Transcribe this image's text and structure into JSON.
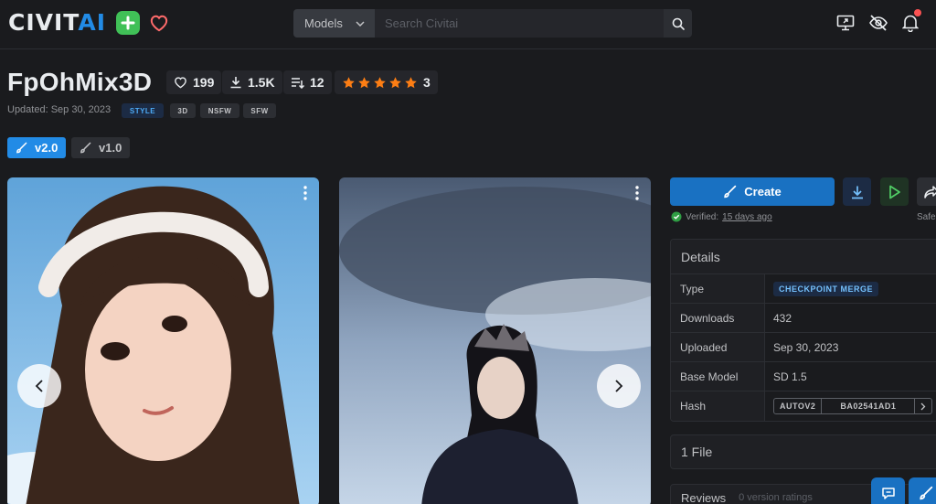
{
  "header": {
    "logo_prefix": "CIVIT",
    "logo_suffix": "AI",
    "search_select": "Models",
    "search_placeholder": "Search Civitai",
    "search_shortcut": "/"
  },
  "model": {
    "title": "FpOhMix3D",
    "likes": "199",
    "downloads": "1.5K",
    "versions_count": "12",
    "rating_stars": 5,
    "rating_count": "3",
    "updated": "Updated: Sep 30, 2023",
    "tags": [
      "STYLE",
      "3D",
      "NSFW",
      "SFW"
    ]
  },
  "versions": [
    {
      "label": "v2.0",
      "active": true
    },
    {
      "label": "v1.0",
      "active": false
    }
  ],
  "actions": {
    "create_label": "Create",
    "verified_prefix": "Verified:",
    "verified_link": "15 days ago",
    "safe_label": "Safe"
  },
  "details": {
    "heading": "Details",
    "type_label": "Type",
    "type_value": "CHECKPOINT MERGE",
    "downloads_label": "Downloads",
    "downloads_value": "432",
    "uploaded_label": "Uploaded",
    "uploaded_value": "Sep 30, 2023",
    "base_model_label": "Base Model",
    "base_model_value": "SD 1.5",
    "hash_label": "Hash",
    "hash_algo": "AUTOV2",
    "hash_value": "BA02541AD1"
  },
  "files": {
    "heading": "1 File"
  },
  "reviews": {
    "heading": "Reviews",
    "sub": "0 version ratings"
  },
  "colors": {
    "accent": "#228be6",
    "logo_plus": "#40c057",
    "heart": "#ff6b6b",
    "star": "#fd7e14",
    "play_green": "#51cf66",
    "notification": "#fa5252"
  }
}
